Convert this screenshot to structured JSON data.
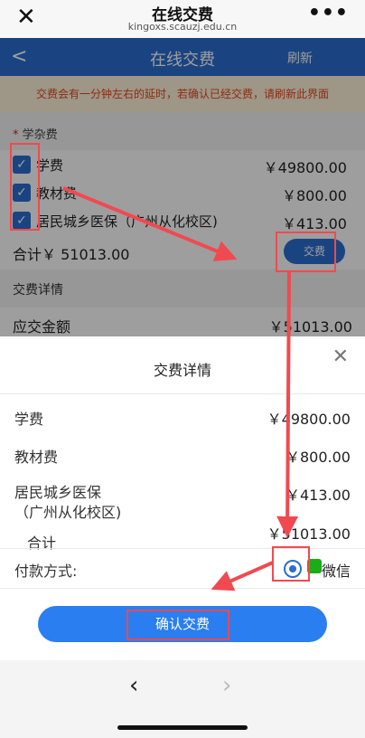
{
  "browser": {
    "title": "在线交费",
    "domain": "kingoxs.scauzj.edu.cn",
    "close_icon": "close-icon",
    "more_icon": "more-icon"
  },
  "header": {
    "title": "在线交费",
    "refresh_label": "刷新",
    "back_icon": "back-icon"
  },
  "notice": "交费会有一分钟左右的延时，若确认已经交费，请刷新此界面",
  "fees_section": {
    "required_mark": "*",
    "label": "学杂费",
    "items": [
      {
        "name": "学费",
        "amount": "￥49800.00",
        "checked": true
      },
      {
        "name": "教材费",
        "amount": "￥800.00",
        "checked": true
      },
      {
        "name": "居民城乡医保（广州从化校区)",
        "amount": "￥413.00",
        "checked": true
      }
    ],
    "total": "合计￥ 51013.00",
    "pay_button": "交费"
  },
  "detail_section": {
    "label": "交费详情",
    "due_label": "应交金额",
    "due_value": "￥51013.00"
  },
  "sheet": {
    "title": "交费详情",
    "rows": [
      {
        "label": "学费",
        "value": "￥49800.00"
      },
      {
        "label": "教材费",
        "value": "￥800.00"
      },
      {
        "label": "居民城乡医保（广州从化校区)",
        "value": "￥413.00"
      },
      {
        "label": "合计",
        "value": "￥51013.00"
      }
    ],
    "payment_label": "付款方式:",
    "payment_method": "微信",
    "confirm_button": "确认交费"
  },
  "colors": {
    "primary": "#2a6fd0",
    "notice_text": "#e5471d",
    "annotation": "#f04a50",
    "wechat_green": "#1aad19"
  }
}
